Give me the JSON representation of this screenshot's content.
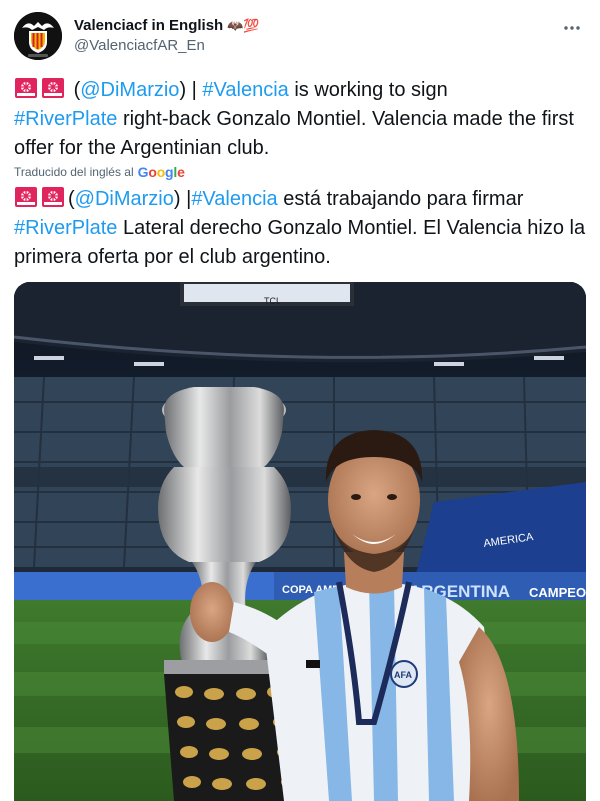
{
  "account": {
    "display_name": "Valenciacf in English",
    "badge_emojis": "🦇💯",
    "handle": "@ValenciacfAR_En",
    "avatar": "valencia-bat-crest-icon"
  },
  "tweet": {
    "english": {
      "flags": [
        "🚨",
        "🚨"
      ],
      "source": "(@DiMarzio)",
      "separator": " | ",
      "hashtag_valencia": "#Valencia",
      "text_1": " is working to sign ",
      "hashtag_riverplate": "#RiverPlate",
      "text_2": " right-back Gonzalo Montiel. Valencia made the first offer for the Argentinian club."
    },
    "translation_label": "Traducido del inglés al",
    "translation_brand": "Google",
    "spanish": {
      "flags": [
        "🚨",
        "🚨"
      ],
      "source": "(@DiMarzio)",
      "separator": " |",
      "hashtag_valencia": "#Valencia",
      "text_1": " está trabajando para firmar ",
      "hashtag_riverplate": "#RiverPlate",
      "text_2": " Lateral derecho Gonzalo Montiel. El Valencia hizo la primera oferta por el club argentino."
    }
  },
  "photo": {
    "scoreboard_text": "TCL",
    "banner_left": "COPA AMERICA",
    "banner_mid": "ARGENTINA",
    "banner_right": "CAMPEO",
    "stand_sign": "AMERICA",
    "shirt_crest": "AFA"
  },
  "colors": {
    "link": "#1d9bf0",
    "text": "#0f1419",
    "secondary": "#536471",
    "siren": "#e0245e"
  }
}
